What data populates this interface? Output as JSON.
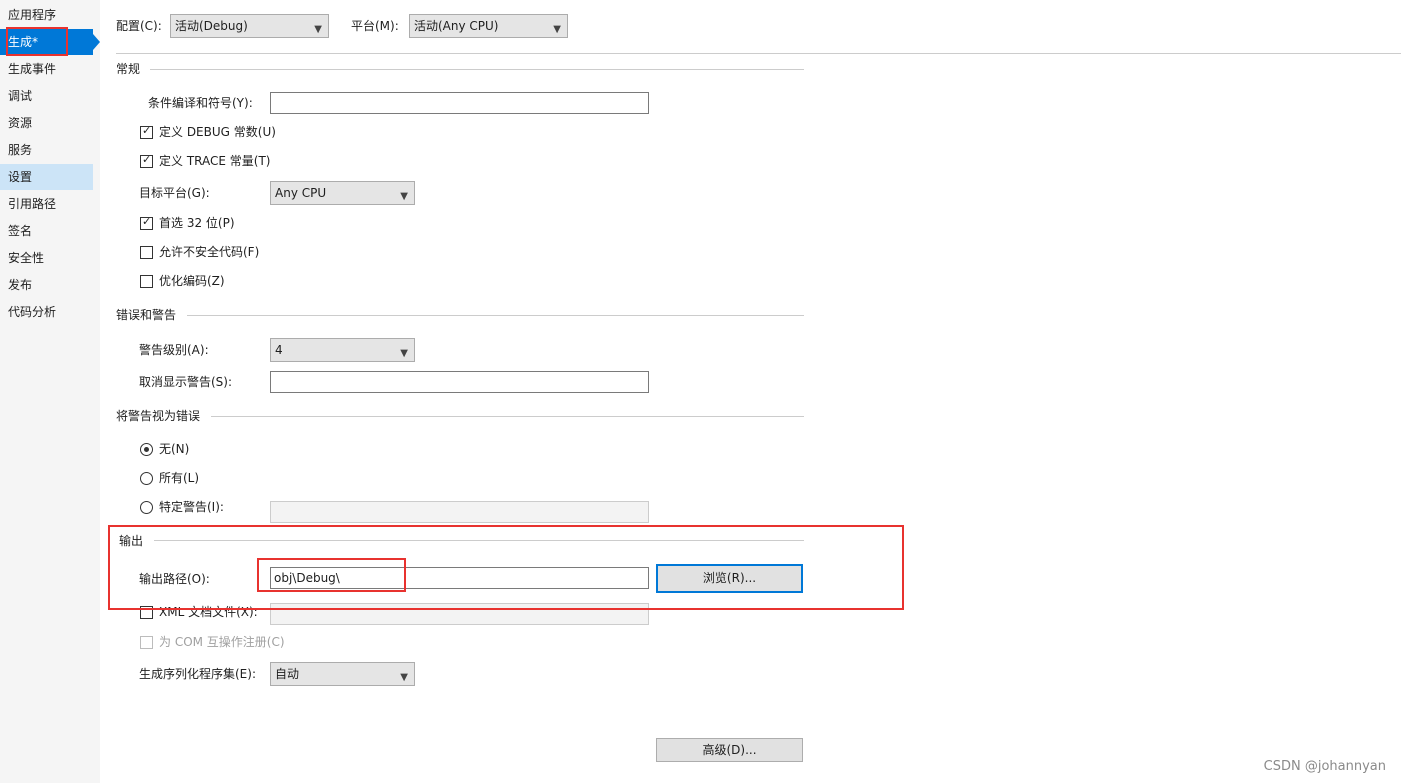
{
  "sidebar": {
    "items": [
      {
        "label": "应用程序"
      },
      {
        "label": "生成*"
      },
      {
        "label": "生成事件"
      },
      {
        "label": "调试"
      },
      {
        "label": "资源"
      },
      {
        "label": "服务"
      },
      {
        "label": "设置"
      },
      {
        "label": "引用路径"
      },
      {
        "label": "签名"
      },
      {
        "label": "安全性"
      },
      {
        "label": "发布"
      },
      {
        "label": "代码分析"
      }
    ]
  },
  "config": {
    "config_label": "配置(C):",
    "config_value": "活动(Debug)",
    "platform_label": "平台(M):",
    "platform_value": "活动(Any CPU)"
  },
  "general": {
    "title": "常规",
    "conditional_label": "条件编译和符号(Y):",
    "conditional_value": "",
    "debug_label": "定义 DEBUG 常数(U)",
    "debug_checked": true,
    "trace_label": "定义 TRACE 常量(T)",
    "trace_checked": true,
    "target_label": "目标平台(G):",
    "target_value": "Any CPU",
    "prefer32_label": "首选 32 位(P)",
    "prefer32_checked": true,
    "unsafe_label": "允许不安全代码(F)",
    "unsafe_checked": false,
    "optimize_label": "优化编码(Z)",
    "optimize_checked": false
  },
  "errors": {
    "title": "错误和警告",
    "level_label": "警告级别(A):",
    "level_value": "4",
    "suppress_label": "取消显示警告(S):",
    "suppress_value": ""
  },
  "treat": {
    "title": "将警告视为错误",
    "none_label": "无(N)",
    "all_label": "所有(L)",
    "specific_label": "特定警告(I):",
    "selected": "none",
    "specific_value": ""
  },
  "output": {
    "title": "输出",
    "path_label": "输出路径(O):",
    "path_value": "obj\\Debug\\",
    "browse_label": "浏览(R)...",
    "xml_label": "XML 文档文件(X):",
    "xml_checked": false,
    "com_label": "为 COM 互操作注册(C)",
    "com_checked": false,
    "serialize_label": "生成序列化程序集(E):",
    "serialize_value": "自动"
  },
  "advanced_label": "高级(D)...",
  "watermark": "CSDN @johannyan",
  "colors": {
    "accent": "#0078d7",
    "highlight_red": "#e8322f",
    "sidebar_hover": "#cce4f7"
  }
}
